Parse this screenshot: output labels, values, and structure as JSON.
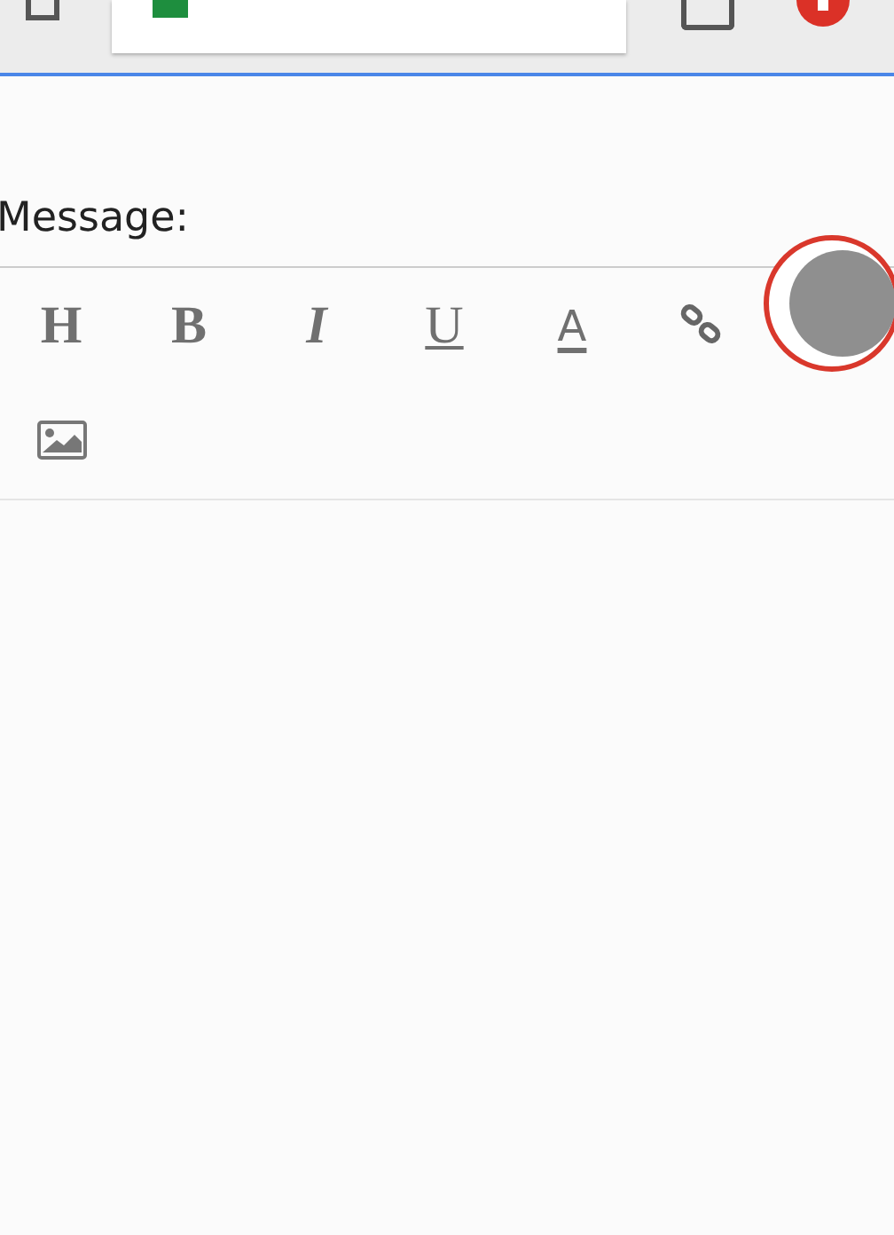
{
  "message_label": "Message:",
  "toolbar": [
    {
      "kind": "text",
      "label": "H"
    },
    {
      "kind": "text",
      "label": "B"
    },
    {
      "kind": "text",
      "label": "I"
    },
    {
      "kind": "text",
      "label": "U"
    },
    {
      "kind": "text",
      "label": "A"
    },
    {
      "kind": "link"
    },
    {
      "kind": "image"
    }
  ]
}
